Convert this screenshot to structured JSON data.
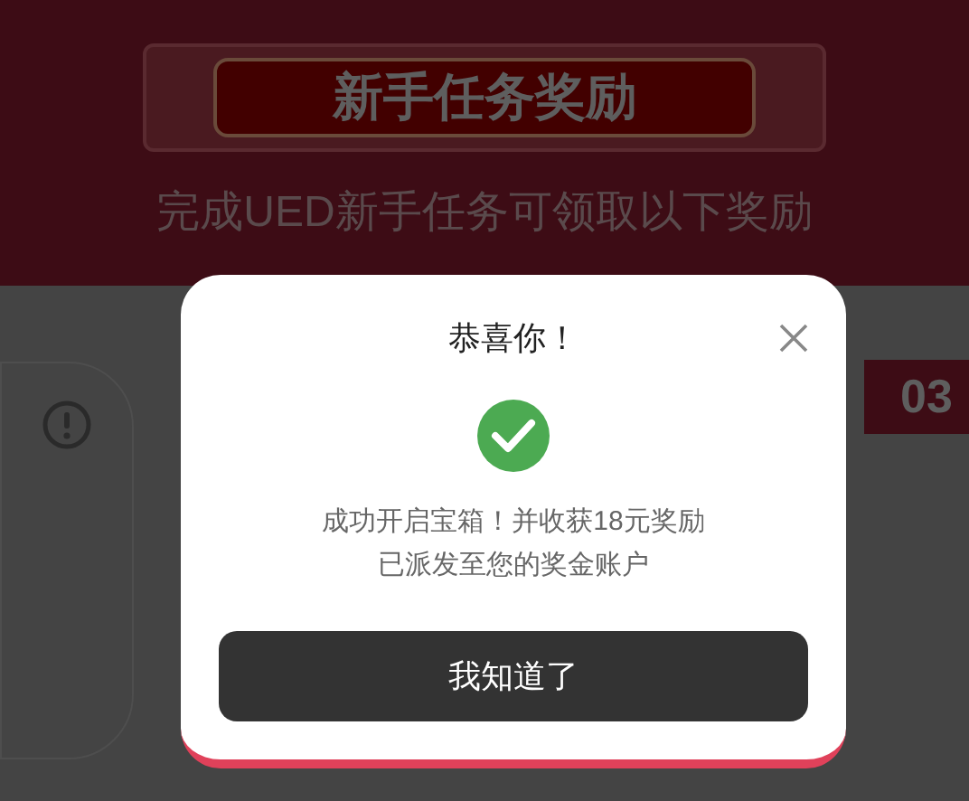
{
  "page": {
    "banner_title": "新手任务奖励",
    "subtitle": "完成UED新手任务可领取以下奖励",
    "step_badge": "03"
  },
  "dialog": {
    "title": "恭喜你！",
    "message_lines": [
      "成功开启宝箱！并收获18元奖励",
      "已派发至您的奖金账户"
    ],
    "button": "我知道了"
  }
}
